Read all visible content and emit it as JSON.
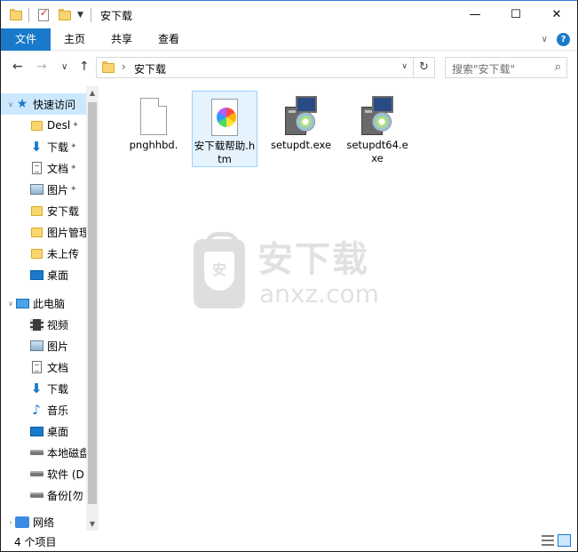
{
  "window": {
    "title": "安下载",
    "controls": {
      "minimize": "—",
      "maximize": "☐",
      "close": "✕"
    }
  },
  "ribbon": {
    "tabs": [
      {
        "label": "文件",
        "active": true
      },
      {
        "label": "主页"
      },
      {
        "label": "共享"
      },
      {
        "label": "查看"
      }
    ],
    "expand_icon": "chevron-down-icon",
    "help_icon": "?"
  },
  "nav": {
    "back": "←",
    "forward": "→",
    "recent": "∨",
    "up": "↑"
  },
  "address": {
    "separator": "›",
    "path": "安下载",
    "dropdown": "∨",
    "refresh": "↻"
  },
  "search": {
    "placeholder": "搜索\"安下载\"",
    "icon": "⌕"
  },
  "navpane": {
    "items": [
      {
        "label": "快速访问",
        "icon": "star-icon",
        "expander": "∨",
        "selected": true,
        "pinned": false
      },
      {
        "label": "Desl",
        "icon": "folder-icon",
        "pinned": true
      },
      {
        "label": "下载",
        "icon": "download-icon",
        "pinned": true
      },
      {
        "label": "文档",
        "icon": "document-icon",
        "pinned": true
      },
      {
        "label": "图片",
        "icon": "picture-icon",
        "pinned": true
      },
      {
        "label": "安下载",
        "icon": "folder-icon"
      },
      {
        "label": "图片管理",
        "icon": "folder-icon"
      },
      {
        "label": "未上传",
        "icon": "folder-icon"
      },
      {
        "label": "桌面",
        "icon": "desktop-icon"
      },
      {
        "label": "此电脑",
        "icon": "computer-icon",
        "expander": "∨"
      },
      {
        "label": "视频",
        "icon": "video-icon"
      },
      {
        "label": "图片",
        "icon": "picture-icon"
      },
      {
        "label": "文档",
        "icon": "document-icon"
      },
      {
        "label": "下载",
        "icon": "download-icon"
      },
      {
        "label": "音乐",
        "icon": "music-icon"
      },
      {
        "label": "桌面",
        "icon": "desktop-icon"
      },
      {
        "label": "本地磁盘",
        "icon": "drive-icon"
      },
      {
        "label": "软件 (D",
        "icon": "drive-icon"
      },
      {
        "label": "备份[勿",
        "icon": "drive-icon"
      },
      {
        "label": "网络",
        "icon": "network-icon",
        "expander": "›"
      }
    ],
    "pin_glyph": "📌",
    "scroll_up": "▲",
    "scroll_down": "▼"
  },
  "files": [
    {
      "name": "pnghhbd.",
      "icon": "blank-file-icon",
      "selected": false
    },
    {
      "name": "安下载帮助.htm",
      "icon": "htm-file-icon",
      "selected": true
    },
    {
      "name": "setupdt.exe",
      "icon": "installer-icon",
      "selected": false
    },
    {
      "name": "setupdt64.exe",
      "icon": "installer-icon",
      "selected": false
    }
  ],
  "watermark": {
    "cn": "安下载",
    "en": "anxz.com",
    "shield_char": "安"
  },
  "status": {
    "item_count": "4 个项目"
  }
}
